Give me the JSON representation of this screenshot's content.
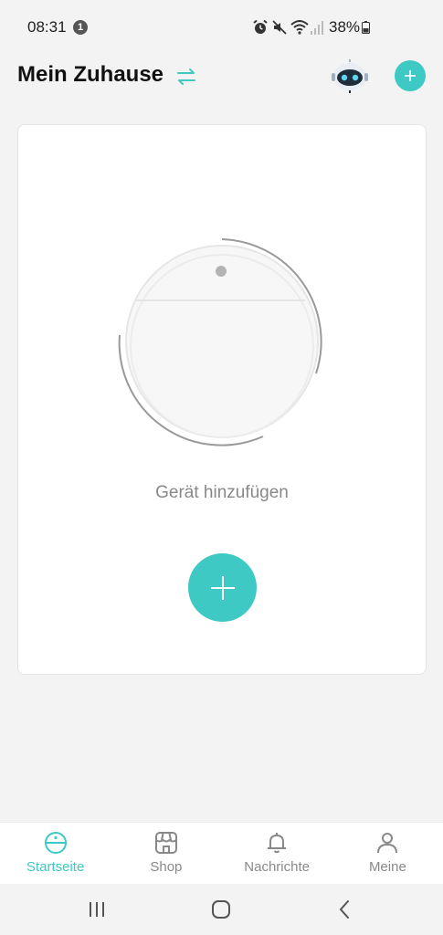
{
  "status_bar": {
    "time": "08:31",
    "notification_count": "1",
    "battery": "38%",
    "icons": [
      "alarm-icon",
      "mute-icon",
      "wifi-icon",
      "signal-icon",
      "battery-icon"
    ]
  },
  "header": {
    "title": "Mein Zuhause",
    "switch_icon": "switch-home-icon",
    "avatar_icon": "robot-assistant-icon",
    "add_icon": "plus-icon"
  },
  "card": {
    "device_illustration": "robot-vacuum-icon",
    "add_device_label": "Gerät hinzufügen",
    "add_device_icon": "plus-icon"
  },
  "bottom_nav": {
    "items": [
      {
        "label": "Startseite",
        "icon": "robot-vacuum-icon",
        "active": true
      },
      {
        "label": "Shop",
        "icon": "store-icon",
        "active": false
      },
      {
        "label": "Nachrichte",
        "icon": "bell-icon",
        "active": false
      },
      {
        "label": "Meine",
        "icon": "user-icon",
        "active": false
      }
    ]
  },
  "system_nav": {
    "recent": "recent-apps-icon",
    "home": "home-icon",
    "back": "back-icon"
  },
  "colors": {
    "accent": "#3ec9c5",
    "background": "#f3f3f3",
    "card": "#ffffff",
    "muted_text": "#888888"
  }
}
